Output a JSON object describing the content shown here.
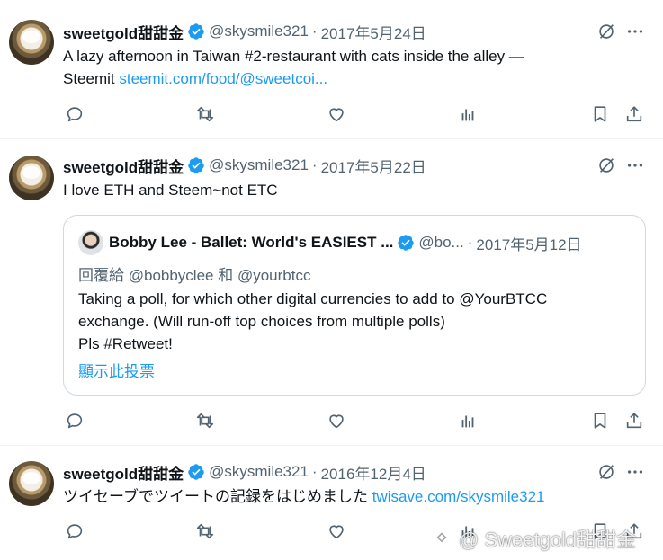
{
  "tweets": [
    {
      "display_name": "sweetgold甜甜金",
      "handle": "@skysmile321",
      "separator": "·",
      "date": "2017年5月24日",
      "text_line1": "A lazy afternoon in Taiwan #2-restaurant with cats inside the alley —",
      "text_line2_prefix": "Steemit ",
      "text_link": "steemit.com/food/@sweetcoi..."
    },
    {
      "display_name": "sweetgold甜甜金",
      "handle": "@skysmile321",
      "separator": "·",
      "date": "2017年5月22日",
      "text": "I love ETH and Steem~not ETC",
      "quote": {
        "display_name": "Bobby Lee - Ballet: World's EASIEST ...",
        "handle": "@bo...",
        "separator": "·",
        "date": "2017年5月12日",
        "reply_prefix": "回覆給 ",
        "reply_to_1": "@bobbyclee",
        "reply_joiner": " 和 ",
        "reply_to_2": "@yourbtcc",
        "body_line1": "Taking a poll, for which other digital currencies to add to @YourBTCC",
        "body_line2": "exchange. (Will run-off top choices from multiple polls)",
        "body_line3": "Pls #Retweet!",
        "poll_link": "顯示此投票"
      }
    },
    {
      "display_name": "sweetgold甜甜金",
      "handle": "@skysmile321",
      "separator": "·",
      "date": "2016年12月4日",
      "text_prefix": "ツイセーブでツイートの記録をはじめました ",
      "text_link": "twisave.com/skysmile321"
    }
  ],
  "icons": {
    "header": [
      "verified-badge-icon",
      "grok-icon",
      "more-icon"
    ],
    "actions": [
      "reply-icon",
      "retweet-icon",
      "like-icon",
      "views-icon",
      "bookmark-icon",
      "share-icon"
    ]
  },
  "watermark": {
    "text": "@ Sweetgold甜甜金"
  },
  "colors": {
    "link": "#1d9bf0",
    "secondary_text": "#536471",
    "primary_text": "#0f1419",
    "border": "#cfd9de",
    "divider": "#eff3f4"
  }
}
